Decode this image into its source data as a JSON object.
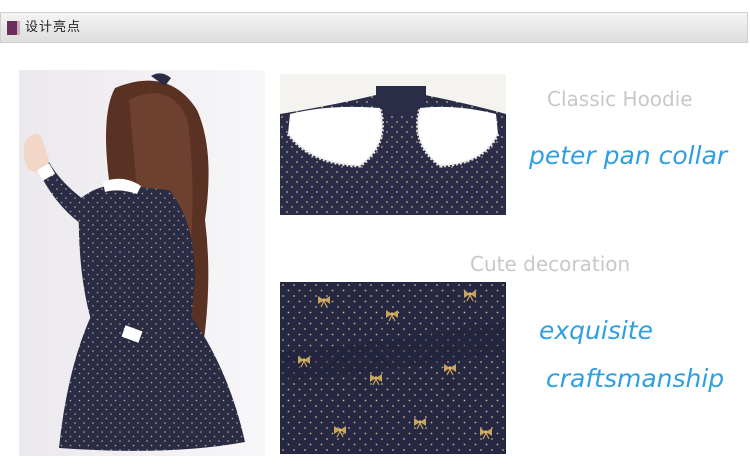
{
  "header": {
    "title": "设计亮点",
    "accent_color": "#6b2d5b"
  },
  "images": {
    "main_photo": "girl-in-navy-dress-photo",
    "collar_detail": "peter-pan-collar-closeup-photo",
    "fabric_detail": "bow-print-fabric-closeup-photo"
  },
  "captions": {
    "classic_hoodie": "Classic Hoodie",
    "peter_pan_collar": "peter pan collar",
    "cute_decoration": "Cute decoration",
    "exquisite": "exquisite",
    "craftsmanship": "craftsmanship"
  },
  "colors": {
    "caption_grey": "#c8c8c8",
    "caption_blue": "#2f9fe3",
    "dress_navy": "#2a2c46"
  }
}
